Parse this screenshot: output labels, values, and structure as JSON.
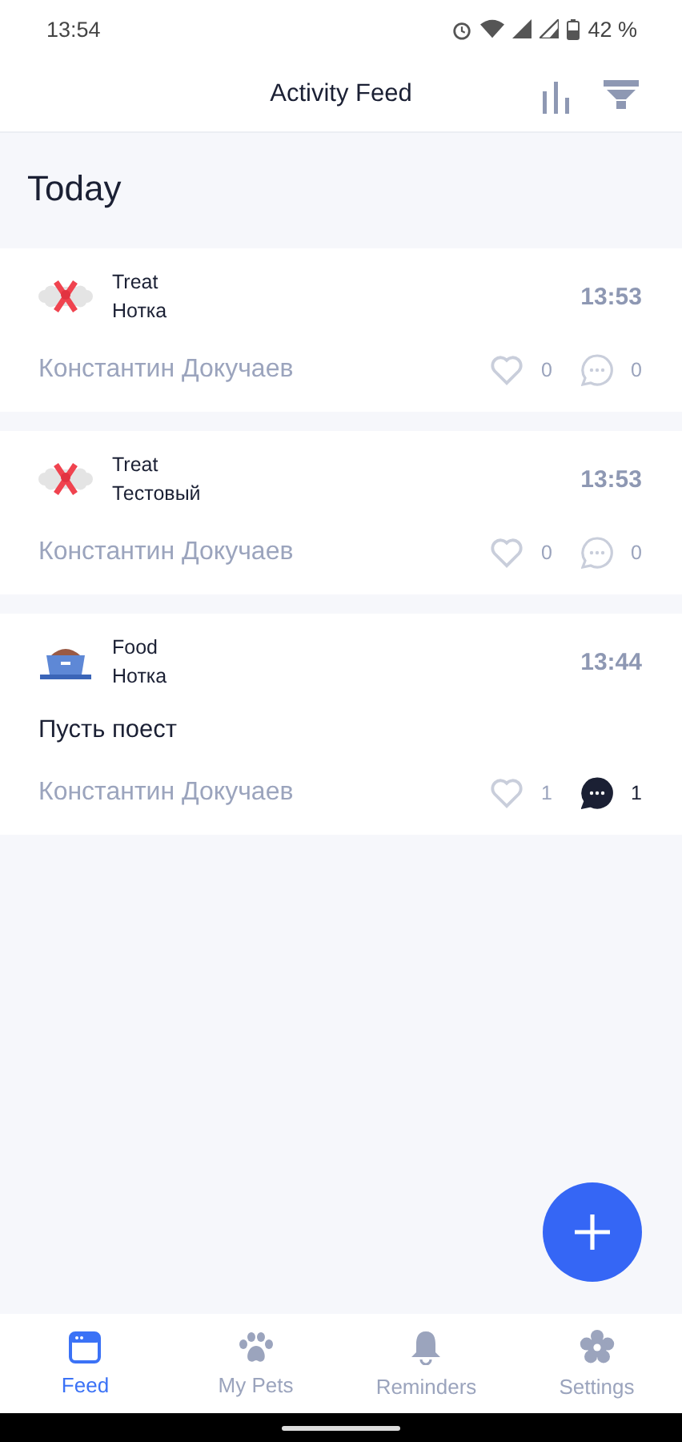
{
  "status_bar": {
    "time": "13:54",
    "battery": "42 %"
  },
  "header": {
    "title": "Activity Feed"
  },
  "section": {
    "title": "Today"
  },
  "posts": [
    {
      "kind": "treat",
      "type": "Treat",
      "pet": "Нотка",
      "time": "13:53",
      "author": "Константин Докучаев",
      "likes": "0",
      "comments": "0",
      "commented": false
    },
    {
      "kind": "treat",
      "type": "Treat",
      "pet": "Тестовый",
      "time": "13:53",
      "author": "Константин Докучаев",
      "likes": "0",
      "comments": "0",
      "commented": false
    },
    {
      "kind": "food",
      "type": "Food",
      "pet": "Нотка",
      "time": "13:44",
      "note": "Пусть поест",
      "author": "Константин Докучаев",
      "likes": "1",
      "comments": "1",
      "commented": true
    }
  ],
  "nav": [
    {
      "kind": "feed",
      "label": "Feed",
      "selected": true
    },
    {
      "kind": "pets",
      "label": "My Pets",
      "selected": false
    },
    {
      "kind": "reminders",
      "label": "Reminders",
      "selected": false
    },
    {
      "kind": "settings",
      "label": "Settings",
      "selected": false
    }
  ]
}
